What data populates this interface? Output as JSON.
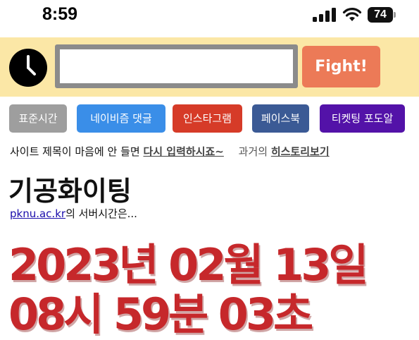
{
  "status_bar": {
    "time": "8:59",
    "battery": "74"
  },
  "search": {
    "input_value": "",
    "fight_label": "Fight!"
  },
  "links": [
    {
      "label": "표준시간",
      "color": "#9e9e9e"
    },
    {
      "label": "네이비즘 댓글",
      "color": "#3a8ee8"
    },
    {
      "label": "인스타그램",
      "color": "#d63b28"
    },
    {
      "label": "페이스북",
      "color": "#3b5a95"
    },
    {
      "label": "티켓팅 포도알",
      "color": "#5312a8"
    }
  ],
  "notice": {
    "text": "사이트 제목이 마음에 안 들면",
    "retry_link": "다시 입력하시죠~",
    "history_prefix": "과거의",
    "history_link": "히스토리보기"
  },
  "site_title": "기공화이팅",
  "server": {
    "domain": "pknu.ac.kr",
    "suffix": "의 서버시간은..."
  },
  "server_time": {
    "date": "2023년 02월 13일",
    "time": "08시 59분 03초"
  },
  "colors": {
    "band": "#fbe7a6",
    "fight": "#ec7a57",
    "time_red": "#c6282b"
  }
}
